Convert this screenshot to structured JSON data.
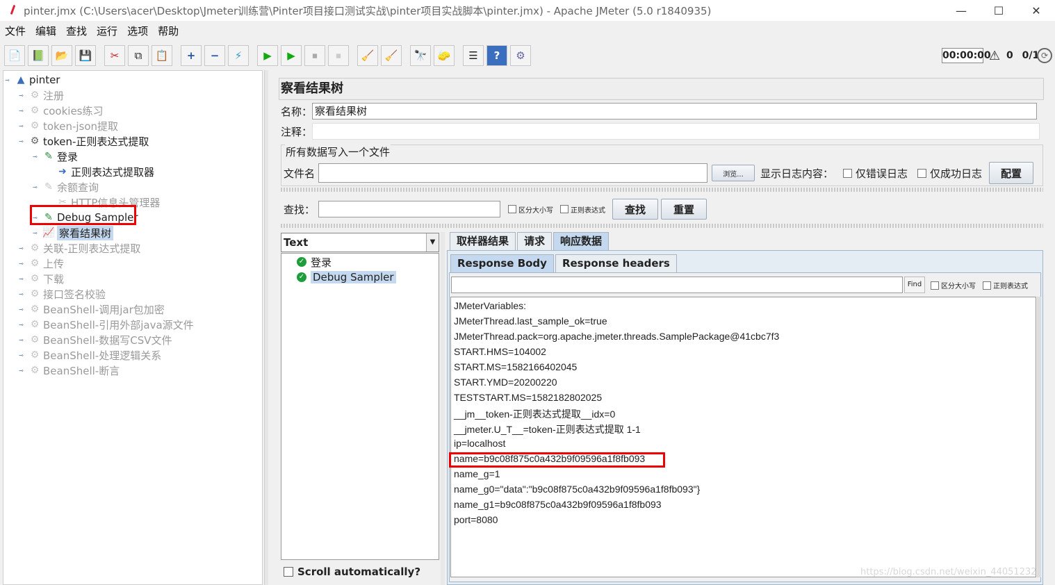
{
  "window": {
    "title": "pinter.jmx (C:\\Users\\acer\\Desktop\\Jmeter训练营\\Pinter项目接口测试实战\\pinter项目实战脚本\\pinter.jmx) - Apache JMeter (5.0 r1840935)",
    "minimize": "—",
    "maximize": "☐",
    "close": "✕"
  },
  "menu": [
    "文件",
    "编辑",
    "查找",
    "运行",
    "选项",
    "帮助"
  ],
  "toolbar": {
    "icons": [
      "📄",
      "📗",
      "📂",
      "💾",
      "✂",
      "⧉",
      "📋",
      "+",
      "−",
      "⚡",
      "▶",
      "▶",
      "⏹",
      "⏹",
      "🧹",
      "🧹",
      "🔭",
      "🧽",
      "☰",
      "?",
      "⚙"
    ],
    "timer": "00:00:00",
    "warning_icon": "⚠",
    "warning_count": "0",
    "thread_count": "0/1",
    "run_indicator": "⟳"
  },
  "tree": {
    "root": "pinter",
    "items": [
      {
        "label": "注册",
        "level": 1,
        "state": "disabled"
      },
      {
        "label": "cookies练习",
        "level": 1,
        "state": "disabled"
      },
      {
        "label": "token-json提取",
        "level": 1,
        "state": "disabled"
      },
      {
        "label": "token-正则表达式提取",
        "level": 1,
        "state": "enabled"
      },
      {
        "label": "登录",
        "level": 2,
        "state": "enabled"
      },
      {
        "label": "正则表达式提取器",
        "level": 3,
        "state": "enabled"
      },
      {
        "label": "余额查询",
        "level": 2,
        "state": "disabled"
      },
      {
        "label": "HTTP信息头管理器",
        "level": 3,
        "state": "disabled"
      },
      {
        "label": "Debug Sampler",
        "level": 2,
        "state": "enabled"
      },
      {
        "label": "察看结果树",
        "level": 2,
        "state": "selected"
      },
      {
        "label": "关联-正则表达式提取",
        "level": 1,
        "state": "disabled"
      },
      {
        "label": "上传",
        "level": 1,
        "state": "disabled"
      },
      {
        "label": "下载",
        "level": 1,
        "state": "disabled"
      },
      {
        "label": "接口签名校验",
        "level": 1,
        "state": "disabled"
      },
      {
        "label": "BeanShell-调用jar包加密",
        "level": 1,
        "state": "disabled"
      },
      {
        "label": "BeanShell-引用外部java源文件",
        "level": 1,
        "state": "disabled"
      },
      {
        "label": "BeanShell-数据写CSV文件",
        "level": 1,
        "state": "disabled"
      },
      {
        "label": "BeanShell-处理逻辑关系",
        "level": 1,
        "state": "disabled"
      },
      {
        "label": "BeanShell-断言",
        "level": 1,
        "state": "disabled"
      }
    ]
  },
  "panel": {
    "title": "察看结果树",
    "name_label": "名称：",
    "name_value": "察看结果树",
    "comment_label": "注释：",
    "comment_value": "",
    "file_section": "所有数据写入一个文件",
    "filename_label": "文件名",
    "filename_value": "",
    "browse_button": "浏览...",
    "log_label": "显示日志内容：",
    "errors_only": "仅错误日志",
    "success_only": "仅成功日志",
    "configure_button": "配置",
    "search_label": "查找：",
    "search_value": "",
    "case_sensitive": "区分大小写",
    "regex": "正则表达式",
    "search_button": "查找",
    "reset_button": "重置"
  },
  "results": {
    "renderer": "Text",
    "renderer_arrow": "▼",
    "samples": [
      {
        "label": "登录",
        "status_icon": "✓"
      },
      {
        "label": "Debug Sampler",
        "status_icon": "✓"
      }
    ],
    "scroll_auto": "Scroll automatically?",
    "tabs": [
      "取样器结果",
      "请求",
      "响应数据"
    ],
    "active_tab": "响应数据",
    "subtabs": [
      "Response Body",
      "Response headers"
    ],
    "active_subtab": "Response Body",
    "find_value": "",
    "find_button": "Find",
    "find_case": "区分大小写",
    "find_regex": "正则表达式",
    "body_lines": [
      "JMeterVariables:",
      "JMeterThread.last_sample_ok=true",
      "JMeterThread.pack=org.apache.jmeter.threads.SamplePackage@41cbc7f3",
      "START.HMS=104002",
      "START.MS=1582166402045",
      "START.YMD=20200220",
      "TESTSTART.MS=1582182802025",
      "__jm__token-正则表达式提取__idx=0",
      "__jmeter.U_T__=token-正则表达式提取 1-1",
      "ip=localhost",
      "name=b9c08f875c0a432b9f09596a1f8fb093",
      "name_g=1",
      "name_g0=\"data\":\"b9c08f875c0a432b9f09596a1f8fb093\"}",
      "name_g1=b9c08f875c0a432b9f09596a1f8fb093",
      "port=8080"
    ]
  },
  "watermark": "https://blog.csdn.net/weixin_44051232",
  "colors": {
    "highlight_box": "#e00000",
    "selection": "#c4d8ef",
    "ok_green": "#1e9e3a"
  }
}
